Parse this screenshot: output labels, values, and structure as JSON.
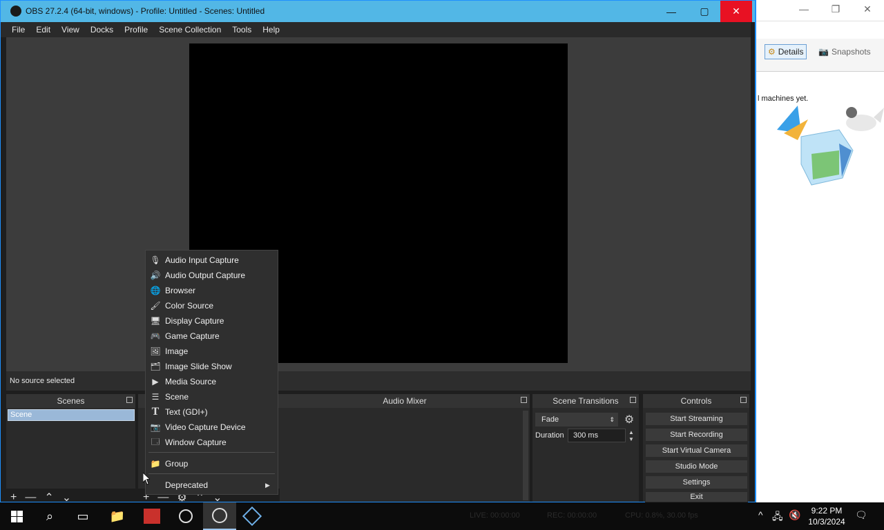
{
  "vbox": {
    "controls": [
      "—",
      "❐",
      "✕"
    ],
    "details_tab": "Details",
    "snapshots_tab": "Snapshots",
    "message_fragment": "l machines yet."
  },
  "obs": {
    "title": "OBS 27.2.4 (64-bit, windows) - Profile: Untitled - Scenes: Untitled",
    "window_controls": {
      "minimize": "—",
      "maximize": "▢",
      "close": "✕"
    },
    "menu": [
      "File",
      "Edit",
      "View",
      "Docks",
      "Profile",
      "Scene Collection",
      "Tools",
      "Help"
    ],
    "status_text": "No source selected",
    "docks": {
      "scenes": {
        "title": "Scenes",
        "items": [
          "Scene"
        ]
      },
      "audio_mixer": {
        "title": "Audio Mixer"
      },
      "scene_transitions": {
        "title": "Scene Transitions",
        "transition": "Fade",
        "duration_label": "Duration",
        "duration_value": "300 ms"
      },
      "controls": {
        "title": "Controls",
        "buttons": [
          "Start Streaming",
          "Start Recording",
          "Start Virtual Camera",
          "Studio Mode",
          "Settings",
          "Exit"
        ]
      }
    },
    "toolbar_glyphs": {
      "add": "+",
      "remove": "—",
      "up": "⌃",
      "down": "⌄",
      "gear": "⚙"
    }
  },
  "context_menu": {
    "items": [
      {
        "label": "Audio Input Capture",
        "icon": "microphone-icon",
        "glyph": "🎙"
      },
      {
        "label": "Audio Output Capture",
        "icon": "speaker-icon",
        "glyph": "🔊"
      },
      {
        "label": "Browser",
        "icon": "globe-icon",
        "glyph": "🌐"
      },
      {
        "label": "Color Source",
        "icon": "paint-brush-icon",
        "glyph": "🖌"
      },
      {
        "label": "Display Capture",
        "icon": "monitor-icon",
        "glyph": "🖥"
      },
      {
        "label": "Game Capture",
        "icon": "gamepad-icon",
        "glyph": "🎮"
      },
      {
        "label": "Image",
        "icon": "image-icon",
        "glyph": "🖼"
      },
      {
        "label": "Image Slide Show",
        "icon": "slideshow-icon",
        "glyph": "🗂"
      },
      {
        "label": "Media Source",
        "icon": "play-icon",
        "glyph": "▶"
      },
      {
        "label": "Scene",
        "icon": "list-icon",
        "glyph": "☰"
      },
      {
        "label": "Text (GDI+)",
        "icon": "text-icon",
        "glyph": "T"
      },
      {
        "label": "Video Capture Device",
        "icon": "camera-icon",
        "glyph": "📷"
      },
      {
        "label": "Window Capture",
        "icon": "window-icon",
        "glyph": "🗔"
      }
    ],
    "group": {
      "label": "Group",
      "icon": "folder-icon",
      "glyph": "📁"
    },
    "deprecated": {
      "label": "Deprecated",
      "arrow": "▶"
    }
  },
  "taskbar": {
    "clock_time": "9:22 PM",
    "clock_date": "10/3/2024",
    "ghost_status": [
      "LIVE: 00:00:00",
      "REC: 00:00:00",
      "CPU: 0.8%, 30.00 fps"
    ]
  }
}
